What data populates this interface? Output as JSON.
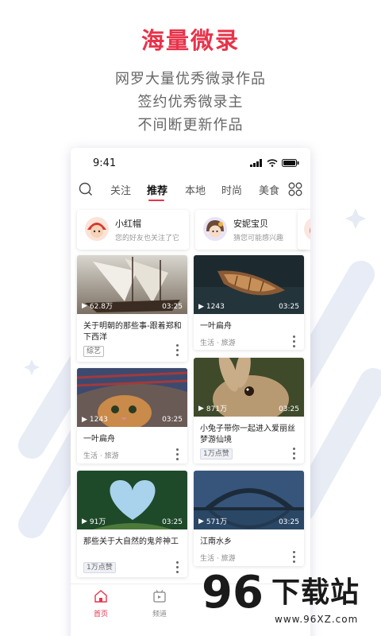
{
  "promo": {
    "headline": "海量微录",
    "lines": [
      "网罗大量优秀微录作品",
      "签约优秀微录主",
      "不间断更新作品"
    ]
  },
  "status_bar": {
    "time": "9:41"
  },
  "tabs": [
    "关注",
    "推荐",
    "本地",
    "时尚",
    "美食"
  ],
  "active_tab": "推荐",
  "recommendations": [
    {
      "name": "小红帽",
      "desc": "您的好友也关注了它"
    },
    {
      "name": "安妮宝贝",
      "desc": "猜您可能感兴趣"
    }
  ],
  "cards": [
    {
      "plays": "62.8万",
      "duration": "03:25",
      "title": "关于明朝的那些事-跟着郑和下西洋",
      "tag": "综艺",
      "meta": ""
    },
    {
      "plays": "1243",
      "duration": "03:25",
      "title": "一叶扁舟",
      "tag": "",
      "meta": "生活 · 旅游"
    },
    {
      "plays": "1243",
      "duration": "03:25",
      "title": "一叶扁舟",
      "tag": "",
      "meta": "生活 · 旅游"
    },
    {
      "plays": "871万",
      "duration": "03:25",
      "title": "小兔子带你一起进入爱丽丝梦游仙境",
      "tag": "1万点赞",
      "meta": ""
    },
    {
      "plays": "91万",
      "duration": "03:25",
      "title": "那些关于大自然的鬼斧神工",
      "tag": "1万点赞",
      "meta": ""
    },
    {
      "plays": "571万",
      "duration": "03:25",
      "title": "江南水乡",
      "tag": "",
      "meta": "生活 · 旅游"
    }
  ],
  "bottom_nav": [
    {
      "label": "首页",
      "icon": "home-icon"
    },
    {
      "label": "频道",
      "icon": "channel-icon"
    }
  ],
  "watermark": {
    "number": "96",
    "text": "下载站",
    "url": "www.96XZ.com"
  },
  "colors": {
    "accent": "#e8334a",
    "tag_border": "#bbbbbb"
  }
}
